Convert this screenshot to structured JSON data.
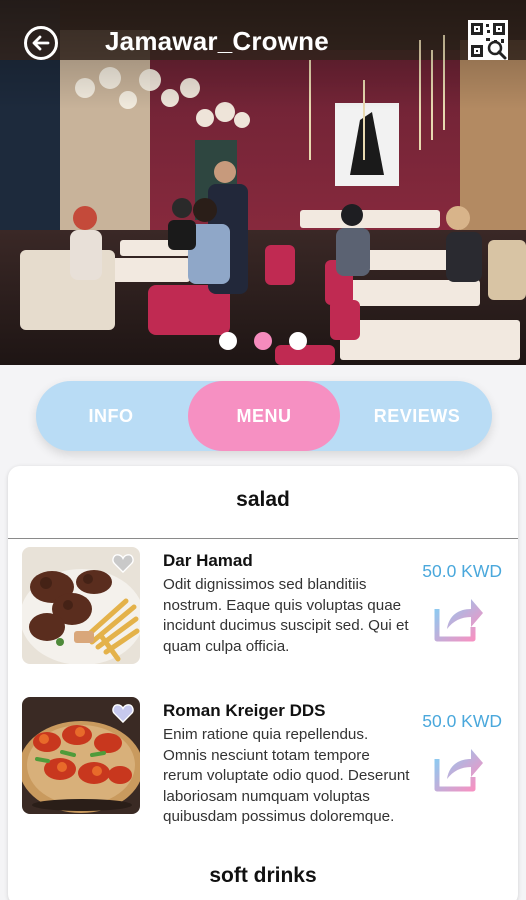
{
  "header": {
    "title": "Jamawar_Crowne",
    "back_icon": "back-arrow-icon",
    "qr_icon": "qr-code-scan-icon"
  },
  "carousel": {
    "count": 3,
    "active_index": 1
  },
  "tabs": [
    {
      "label": "INFO",
      "active": false
    },
    {
      "label": "MENU",
      "active": true
    },
    {
      "label": "REVIEWS",
      "active": false
    }
  ],
  "colors": {
    "accent_pink": "#f690c2",
    "tab_blue": "#b9dcf5",
    "price_blue": "#4aa8dc"
  },
  "menu": {
    "sections": [
      {
        "title": "salad",
        "items": [
          {
            "name": "Dar Hamad",
            "description": "Odit dignissimos sed blanditiis nostrum. Eaque quis voluptas quae incidunt ducimus suscipit sed. Qui et quam culpa officia.",
            "price": "50.0 KWD",
            "favorite": false
          },
          {
            "name": "Roman Kreiger DDS",
            "description": "Enim ratione quia repellendus. Omnis nesciunt totam tempore rerum voluptate odio quod. Deserunt laboriosam numquam voluptas quibusdam possimus doloremque.",
            "price": "50.0 KWD",
            "favorite": false
          }
        ]
      },
      {
        "title": "soft drinks",
        "items": []
      }
    ]
  }
}
